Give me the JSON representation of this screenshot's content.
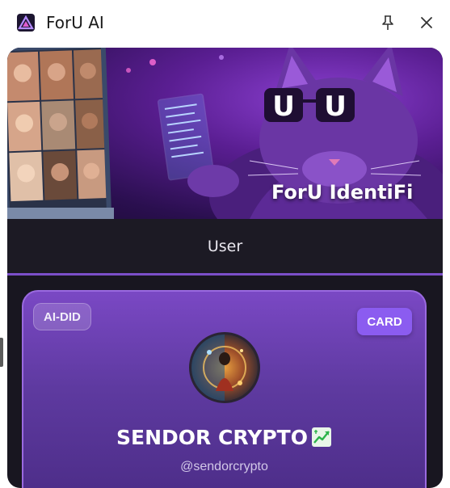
{
  "window": {
    "title": "ForU AI",
    "pin_icon": "pin-icon",
    "close_icon": "close-icon"
  },
  "banner": {
    "title": "ForU IdentiFi",
    "cat_glasses_text": "U U"
  },
  "tabs": [
    {
      "label": "User",
      "active": true
    }
  ],
  "card": {
    "badge": "AI-DID",
    "action_label": "CARD",
    "name": "SENDOR CRYPTO",
    "name_icon": "chart-increasing-icon",
    "handle": "@sendorcrypto"
  },
  "colors": {
    "accent": "#7b4fc9",
    "card_button": "#8b5cf0",
    "panel_bg": "#181620"
  }
}
